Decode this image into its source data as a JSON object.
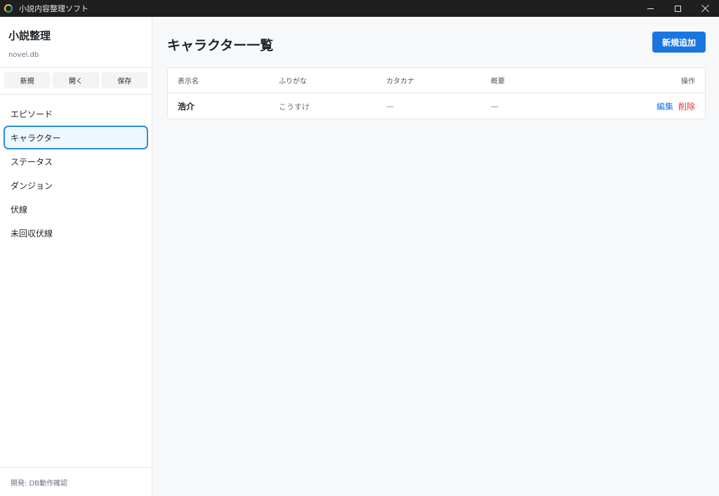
{
  "window": {
    "title": "小説内容整理ソフト"
  },
  "sidebar": {
    "app_name": "小説整理",
    "file_name": "novel.db",
    "file_actions": {
      "new": "新規",
      "open": "開く",
      "save": "保存"
    },
    "nav_items": [
      {
        "label": "エピソード",
        "active": false
      },
      {
        "label": "キャラクター",
        "active": true
      },
      {
        "label": "ステータス",
        "active": false
      },
      {
        "label": "ダンジョン",
        "active": false
      },
      {
        "label": "伏線",
        "active": false
      },
      {
        "label": "未回収伏線",
        "active": false
      }
    ],
    "footer": "開発: DB動作確認"
  },
  "main": {
    "title": "キャラクター一覧",
    "add_button": "新規追加",
    "table": {
      "headers": {
        "name": "表示名",
        "furigana": "ふりがな",
        "katakana": "カタカナ",
        "summary": "概要",
        "actions": "操作"
      },
      "rows": [
        {
          "name": "浩介",
          "furigana": "こうすけ",
          "katakana": "—",
          "summary": "—",
          "edit": "編集",
          "delete": "削除"
        }
      ]
    }
  },
  "colors": {
    "accent": "#1976e0",
    "danger": "#e0342f",
    "active_border": "#2f8bd6",
    "active_bg": "#eef6fe"
  }
}
